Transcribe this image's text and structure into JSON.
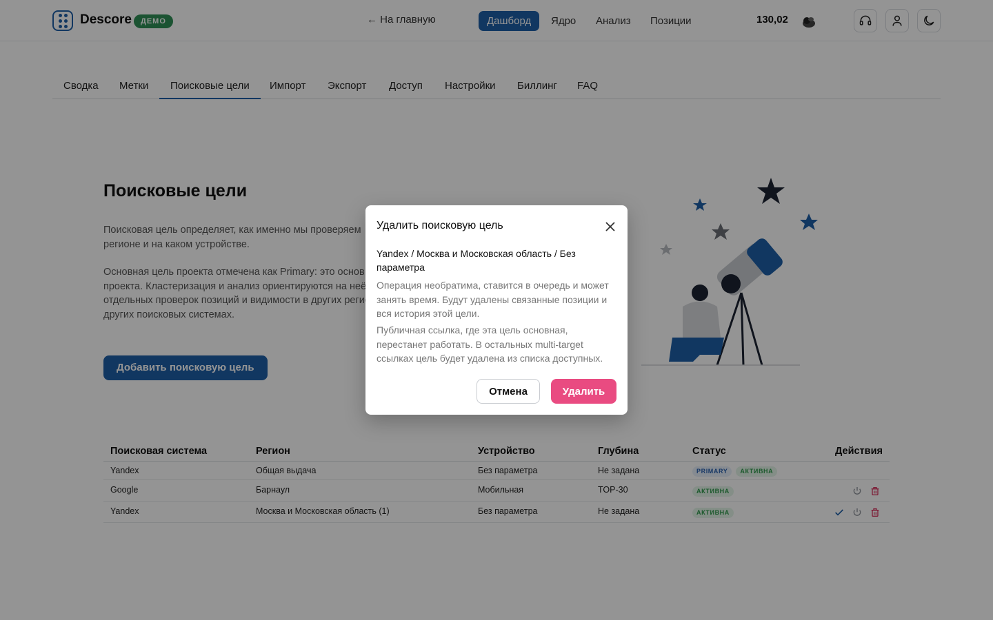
{
  "header": {
    "brand": "Descore",
    "demo_badge": "ДЕМО",
    "back_link": "← На главную",
    "nav": [
      "Дашборд",
      "Ядро",
      "Анализ",
      "Позиции"
    ],
    "balance": "130,02"
  },
  "tabs": [
    "Сводка",
    "Метки",
    "Поисковые цели",
    "Импорт",
    "Экспорт",
    "Доступ",
    "Настройки",
    "Биллинг",
    "FAQ"
  ],
  "hero": {
    "title": "Поисковые цели",
    "p1_line1": "Поисковая цель определяет, как именно мы проверяем",
    "p1_line2": "регионе и на каком устройстве.",
    "p2_line1": "Основная цель проекта отмечена как Primary: это основ",
    "p2_line2": "проекта. Кластеризация и анализ ориентируются на неё",
    "p2_line3": "отдельных проверок позиций и видимости в других регио",
    "p2_line4": "других поисковых системах.",
    "add_button": "Добавить поисковую цель"
  },
  "table": {
    "headers": [
      "Поисковая система",
      "Регион",
      "Устройство",
      "Глубина",
      "Статус",
      "Действия"
    ],
    "rows": [
      {
        "engine": "Yandex",
        "region": "Общая выдача",
        "device": "Без параметра",
        "depth": "Не задана",
        "badges": [
          "PRIMARY",
          "АКТИВНА"
        ]
      },
      {
        "engine": "Google",
        "region": "Барнаул",
        "device": "Мобильная",
        "depth": "TOP-30",
        "badges": [
          "АКТИВНА"
        ]
      },
      {
        "engine": "Yandex",
        "region": "Москва и Московская область (1)",
        "device": "Без параметра",
        "depth": "Не задана",
        "badges": [
          "АКТИВНА"
        ]
      }
    ]
  },
  "modal": {
    "title": "Удалить поисковую цель",
    "target": "Yandex / Москва и Московская область / Без параметра",
    "warning": "Операция необратима, ставится в очередь и может занять время. Будут удалены связанные позиции и вся история этой цели.",
    "public_link_note": "Публичная ссылка, где эта цель основная, перестанет работать. В остальных multi-target ссылках цель будет удалена из списка доступных.",
    "cancel": "Отмена",
    "delete": "Удалить"
  },
  "colors": {
    "accent": "#1e5fa8",
    "danger": "#e94b81",
    "demo_badge": "#2f8f56"
  },
  "icons": [
    "logo-grid-icon",
    "headset-icon",
    "user-icon",
    "moon-icon",
    "close-icon",
    "check-icon",
    "power-icon",
    "trash-icon"
  ]
}
